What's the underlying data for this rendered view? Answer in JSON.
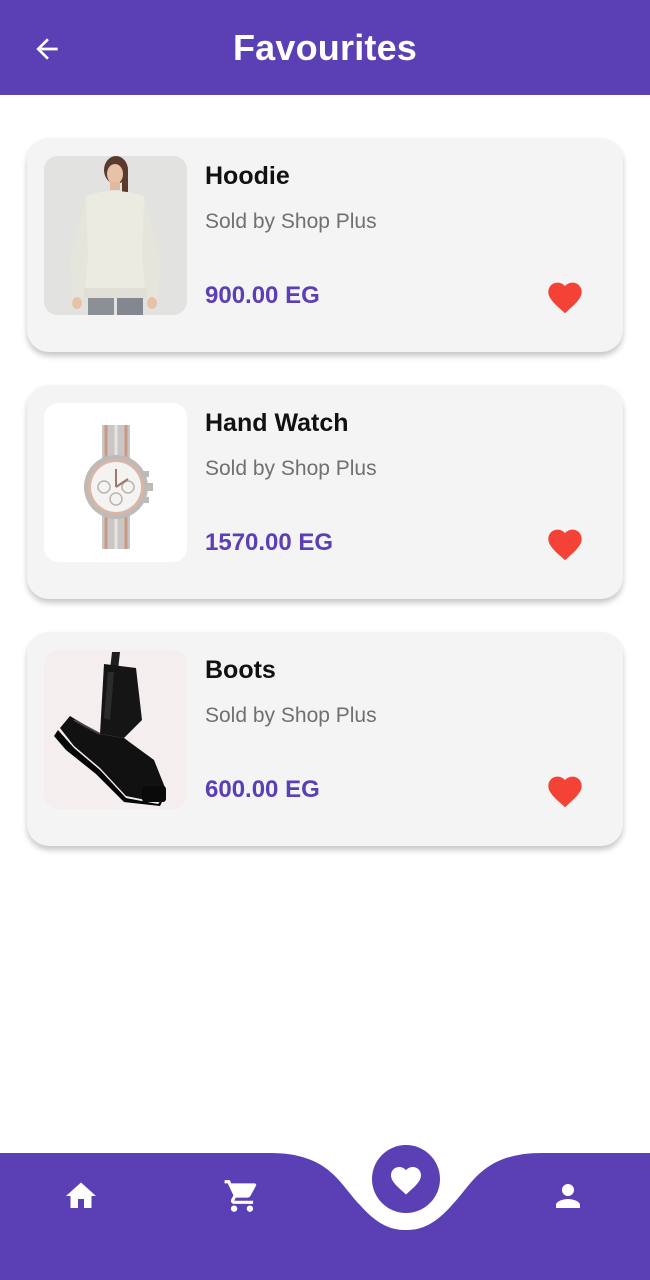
{
  "appbar": {
    "title": "Favourites",
    "back_icon": "arrow-back-icon",
    "color": "#5a3fb5"
  },
  "favourites": [
    {
      "name": "Hoodie",
      "seller": "Sold by Shop Plus",
      "price": "900.00 EG",
      "image": "hoodie",
      "favourite_icon": "heart-icon"
    },
    {
      "name": "Hand Watch",
      "seller": "Sold by Shop Plus",
      "price": "1570.00 EG",
      "image": "wrist-watch",
      "favourite_icon": "heart-icon"
    },
    {
      "name": "Boots",
      "seller": "Sold by Shop Plus",
      "price": "600.00 EG",
      "image": "rubber-boot",
      "favourite_icon": "heart-icon"
    }
  ],
  "bottom_nav": {
    "items": [
      {
        "icon": "home-icon",
        "active": false
      },
      {
        "icon": "cart-icon",
        "active": false
      },
      {
        "icon": "heart-icon",
        "active": true
      },
      {
        "icon": "person-icon",
        "active": false
      }
    ]
  },
  "colors": {
    "primary": "#5a3fb5",
    "favourite": "#f44336",
    "card": "#f4f4f4"
  }
}
